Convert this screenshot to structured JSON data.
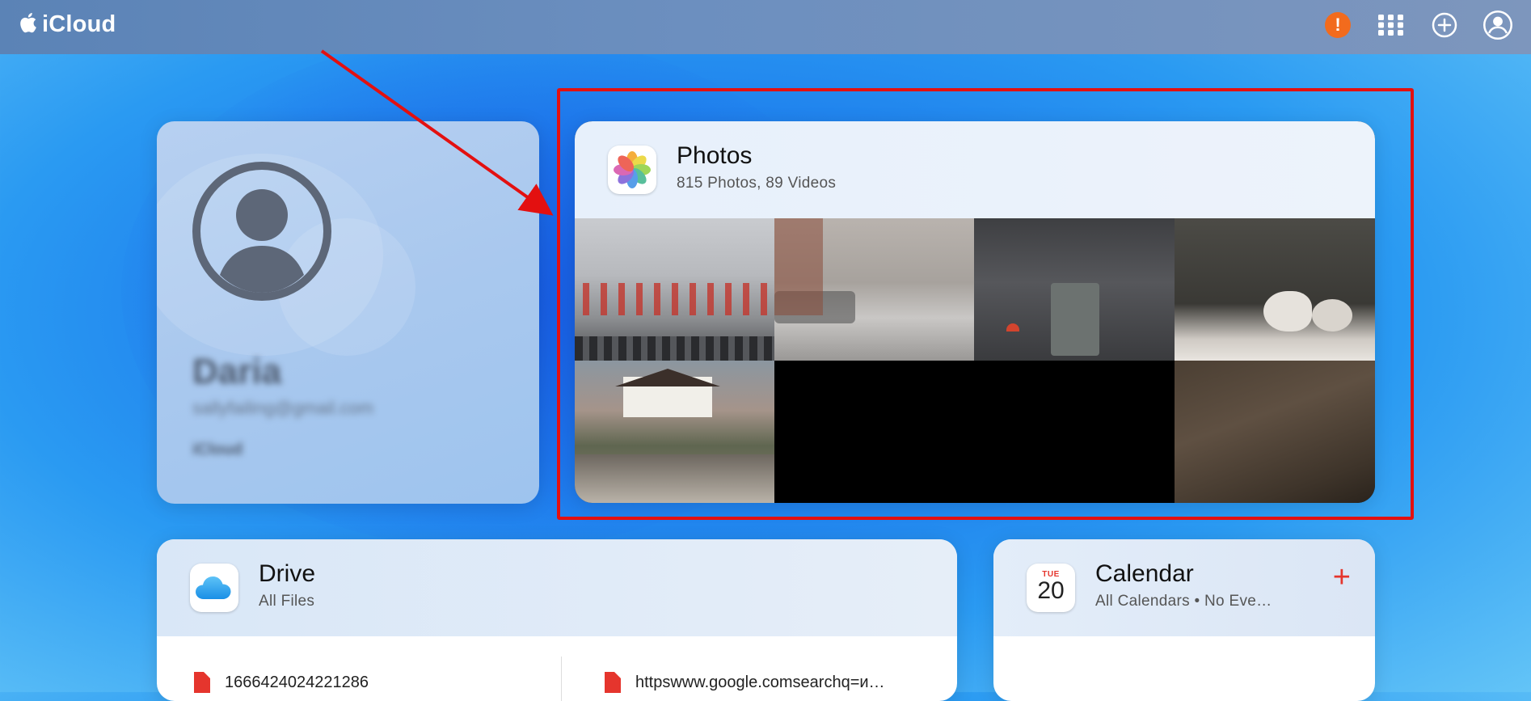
{
  "topbar": {
    "brand_label": "iCloud",
    "alert_symbol": "!",
    "icons": [
      "alert-icon",
      "app-grid-icon",
      "add-icon",
      "account-icon"
    ]
  },
  "profile": {
    "name": "Daria",
    "email": "sallyfailing@gmail.com",
    "plan": "iCloud"
  },
  "photos": {
    "title": "Photos",
    "subtitle": "815 Photos, 89 Videos"
  },
  "drive": {
    "title": "Drive",
    "subtitle": "All Files",
    "files": [
      {
        "name": "1666424024221286"
      },
      {
        "name": "httpswww.google.comsearchq=и…"
      }
    ]
  },
  "calendar": {
    "title": "Calendar",
    "subtitle": "All Calendars • No Eve…",
    "day": "TUE",
    "date": "20",
    "add_symbol": "+"
  },
  "colors": {
    "accent_red": "#e31010",
    "alert_orange": "#f26b1d"
  }
}
